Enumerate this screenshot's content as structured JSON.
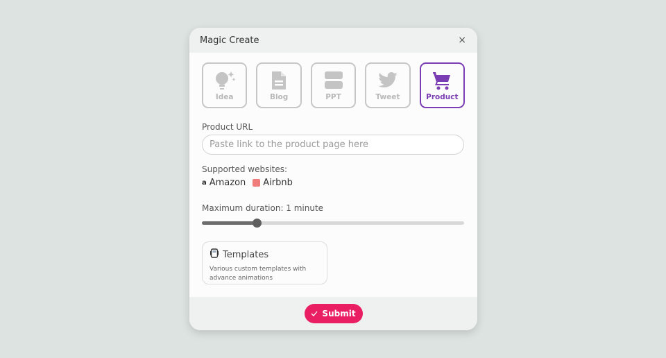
{
  "modal": {
    "title": "Magic Create",
    "close_label": "×"
  },
  "types": [
    {
      "label": "Idea",
      "icon": "lightbulb-icon",
      "active": false
    },
    {
      "label": "Blog",
      "icon": "document-icon",
      "active": false
    },
    {
      "label": "PPT",
      "icon": "slides-icon",
      "active": false
    },
    {
      "label": "Tweet",
      "icon": "twitter-icon",
      "active": false
    },
    {
      "label": "Product",
      "icon": "cart-icon",
      "active": true
    }
  ],
  "form": {
    "url_label": "Product URL",
    "url_value": "",
    "url_placeholder": "Paste link to the product page here",
    "supported_label": "Supported websites:",
    "sites": [
      {
        "name": "Amazon",
        "icon": "amazon-icon"
      },
      {
        "name": "Airbnb",
        "icon": "airbnb-icon"
      }
    ],
    "duration_label": "Maximum duration: 1 minute",
    "duration_fraction": 0.21
  },
  "templates": {
    "title": "Templates",
    "description": "Various custom templates with advance animations"
  },
  "footer": {
    "submit_label": "Submit"
  },
  "colors": {
    "accent": "#7b3db4",
    "submit": "#e91e63"
  }
}
